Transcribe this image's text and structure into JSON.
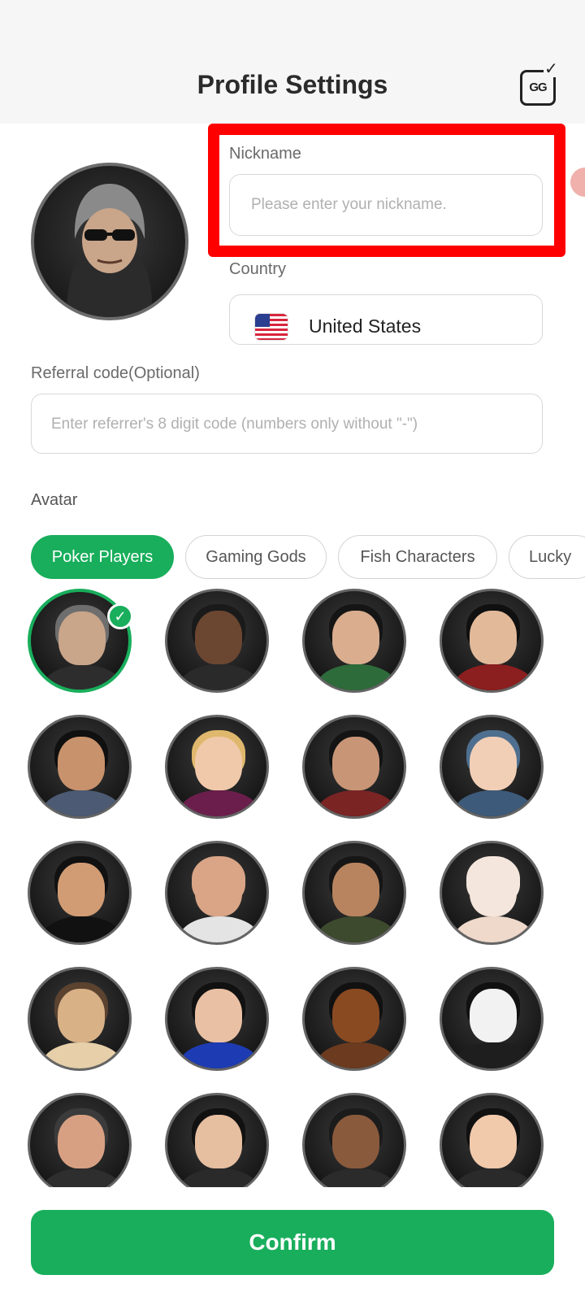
{
  "header": {
    "title": "Profile Settings",
    "gg_button_label": "GG",
    "gg_button_check": "✓"
  },
  "nickname": {
    "label": "Nickname",
    "placeholder": "Please enter your nickname.",
    "value": ""
  },
  "country": {
    "label": "Country",
    "selected": "United States",
    "flag_icon": "us-flag-icon"
  },
  "referral": {
    "label": "Referral code(Optional)",
    "placeholder": "Enter referrer's 8 digit code (numbers only without \"-\")",
    "value": ""
  },
  "avatar_section": {
    "label": "Avatar",
    "tabs": [
      {
        "label": "Poker Players",
        "active": true
      },
      {
        "label": "Gaming Gods",
        "active": false
      },
      {
        "label": "Fish Characters",
        "active": false
      },
      {
        "label": "Lucky",
        "active": false
      }
    ],
    "selected_index": 0,
    "check_icon": "✓",
    "avatars": [
      {
        "name": "hooded-man-sunglasses",
        "face": "#c9a58a",
        "body": "#2d2d2d",
        "hair": "#6e6e6e"
      },
      {
        "name": "man-suit",
        "face": "#6b4631",
        "body": "#2a2a2a",
        "hair": "#1a1a1a"
      },
      {
        "name": "angry-boy",
        "face": "#d9ad8e",
        "body": "#2e6b3a",
        "hair": "#151515"
      },
      {
        "name": "smiling-man-red",
        "face": "#e2b999",
        "body": "#8b1e1e",
        "hair": "#101010"
      },
      {
        "name": "mustache-man",
        "face": "#c8926c",
        "body": "#4c5b73",
        "hair": "#101010"
      },
      {
        "name": "blonde-woman",
        "face": "#f0c9aa",
        "body": "#6b1e4c",
        "hair": "#e0b86d"
      },
      {
        "name": "long-hair-man",
        "face": "#c99577",
        "body": "#7a2424",
        "hair": "#141414"
      },
      {
        "name": "hooded-kid-sunglasses",
        "face": "#f1cfb6",
        "body": "#3d5a7a",
        "hair": "#4e6f8f"
      },
      {
        "name": "big-man-sunglasses",
        "face": "#d19c74",
        "body": "#111111",
        "hair": "#111111"
      },
      {
        "name": "bald-mustache-man",
        "face": "#d9a586",
        "body": "#e4e4e4",
        "hair": "#d9a586"
      },
      {
        "name": "scowling-man",
        "face": "#b7845f",
        "body": "#3d4a2e",
        "hair": "#161616"
      },
      {
        "name": "white-cat",
        "face": "#f4e6dc",
        "body": "#efd9cb",
        "hair": "#f4e6dc"
      },
      {
        "name": "pug-dog",
        "face": "#d8b186",
        "body": "#e6cfa9",
        "hair": "#5b4330"
      },
      {
        "name": "woman-blue-dress",
        "face": "#eac0a4",
        "body": "#1d3bb3",
        "hair": "#111111"
      },
      {
        "name": "doberman-dog",
        "face": "#8a4a21",
        "body": "#6b3a1f",
        "hair": "#111111"
      },
      {
        "name": "panda",
        "face": "#f2f2f2",
        "body": "#1e1e1e",
        "hair": "#111111"
      },
      {
        "name": "man-fedora",
        "face": "#d8a082",
        "body": "#2e2e2e",
        "hair": "#3b3b3b"
      },
      {
        "name": "young-man-suit",
        "face": "#e6bea0",
        "body": "#2a2a2a",
        "hair": "#111111"
      },
      {
        "name": "curly-hair-woman",
        "face": "#8a5a3c",
        "body": "#2b2b2b",
        "hair": "#1b1b1b"
      },
      {
        "name": "short-hair-woman",
        "face": "#f1c9ab",
        "body": "#2a2a2a",
        "hair": "#111111"
      }
    ]
  },
  "confirm_button": {
    "label": "Confirm"
  },
  "colors": {
    "accent": "#19ae5c",
    "highlight": "#ff0000"
  }
}
